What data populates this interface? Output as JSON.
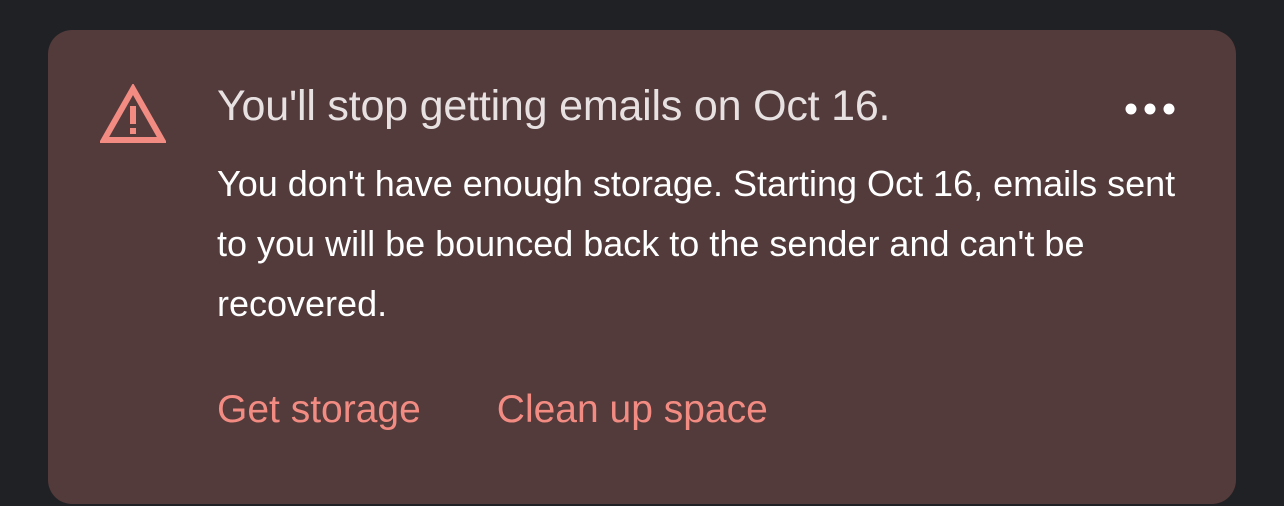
{
  "banner": {
    "title": "You'll stop getting emails on Oct 16.",
    "message": "You don't have enough storage. Starting Oct 16, emails sent to you will be bounced back to the sender and can't be recovered.",
    "actions": {
      "get_storage": "Get storage",
      "clean_up": "Clean up space"
    },
    "icons": {
      "status": "warning-icon",
      "menu": "more-options-icon"
    }
  },
  "colors": {
    "page_background": "#202124",
    "card_background": "#533a3b",
    "accent": "#f28b82",
    "title_text": "#e8e1e2",
    "body_text": "#ffffff"
  }
}
